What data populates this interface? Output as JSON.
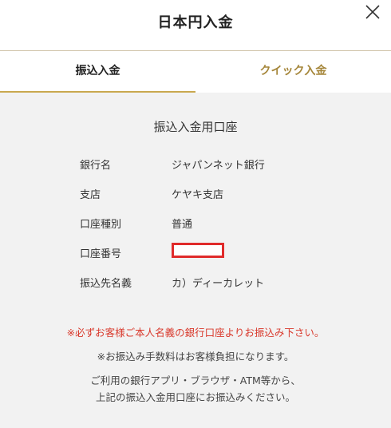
{
  "header": {
    "title": "日本円入金",
    "close_icon": "close-icon"
  },
  "tabs": [
    {
      "label": "振込入金",
      "active": true
    },
    {
      "label": "クイック入金",
      "active": false
    }
  ],
  "panel": {
    "title": "振込入金用口座",
    "rows": [
      {
        "label": "銀行名",
        "value": "ジャパンネット銀行"
      },
      {
        "label": "支店",
        "value": "ケヤキ支店"
      },
      {
        "label": "口座種別",
        "value": "普通"
      },
      {
        "label": "口座番号",
        "value": ""
      },
      {
        "label": "振込先名義",
        "value": "カ）ディーカレット"
      }
    ],
    "notice_warning": "※必ずお客様ご本人名義の銀行口座よりお振込み下さい。",
    "notice_fee": "※お振込み手数料はお客様負担になります。",
    "notice_guide_line1": "ご利用の銀行アプリ・ブラウザ・ATM等から、",
    "notice_guide_line2": "上記の振込入金用口座にお振込みください。"
  },
  "colors": {
    "accent_gold": "#c9a84f",
    "inactive_tab_text": "#a5863a",
    "warning_red": "#d9392c",
    "panel_bg": "#f2f2f2"
  }
}
